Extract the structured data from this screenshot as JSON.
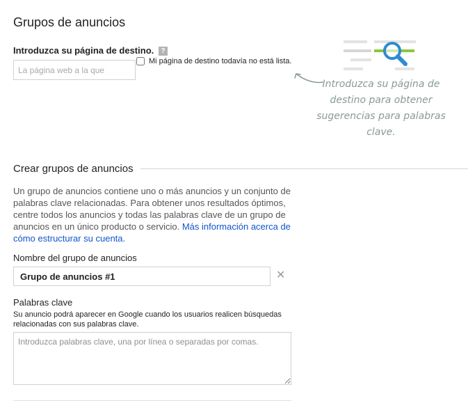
{
  "page": {
    "title": "Grupos de anuncios"
  },
  "landing_page": {
    "label": "Introduzca su página de destino.",
    "help_icon": "?",
    "input_placeholder": "La página web a la que",
    "input_value": "",
    "no_page_checkbox_label": "Mi página de destino todavía no está lista.",
    "no_page_checked": false
  },
  "hint": {
    "illustration_icon": "magnifier-over-lines-icon",
    "arrow_icon": "curved-arrow-left-icon",
    "text": "Introduzca su página de destino para obtener sugerencias para palabras clave.",
    "colors": {
      "accent_green": "#8cc63f",
      "accent_blue": "#2e8ccf",
      "text": "#8a9a96"
    }
  },
  "create_groups": {
    "title": "Crear grupos de anuncios",
    "intro_text": "Un grupo de anuncios contiene uno o más anuncios y un conjunto de palabras clave relacionadas. Para obtener unos resultados óptimos, centre todos los anuncios y todas las palabras clave de un grupo de anuncios en un único producto o servicio.",
    "intro_link": "Más información acerca de cómo estructurar su cuenta.",
    "link_color": "#1155cc"
  },
  "ad_group_name": {
    "label": "Nombre del grupo de anuncios",
    "value": "Grupo de anuncios #1",
    "clear_icon": "✕"
  },
  "keywords": {
    "label": "Palabras clave",
    "help_text": "Su anuncio podrá aparecer en Google cuando los usuarios realicen búsquedas relacionadas con sus palabras clave.",
    "placeholder": "Introduzca palabras clave, una por línea o separadas por comas.",
    "value": ""
  }
}
